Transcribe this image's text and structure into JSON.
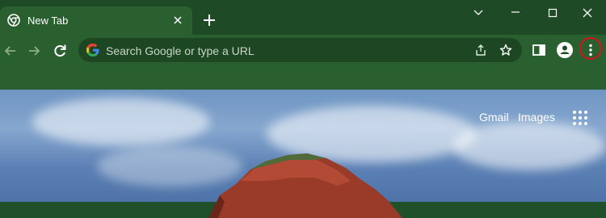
{
  "tab": {
    "title": "New Tab",
    "favicon": "chrome-icon",
    "close": "close-icon"
  },
  "new_tab": {
    "icon": "plus-icon"
  },
  "window_controls": {
    "dropdown": "chevron-down-icon",
    "minimize": "minimize-icon",
    "maximize": "maximize-icon",
    "close": "close-icon"
  },
  "toolbar": {
    "back": "arrow-left-icon",
    "forward": "arrow-right-icon",
    "reload": "reload-icon",
    "side_panel": "side-panel-icon",
    "profile": "person-icon",
    "menu": "three-dots-vertical-icon"
  },
  "omnibox": {
    "placeholder": "Search Google or type a URL",
    "share": "share-icon",
    "bookmark": "star-icon"
  },
  "ntp": {
    "gmail": "Gmail",
    "images": "Images",
    "apps": "grid-icon"
  },
  "colors": {
    "titlebar": "#1f4a26",
    "toolbar": "#2a5f2f",
    "omnibox": "#1c4722",
    "highlight": "#d4141b",
    "text": "#ffffff"
  }
}
